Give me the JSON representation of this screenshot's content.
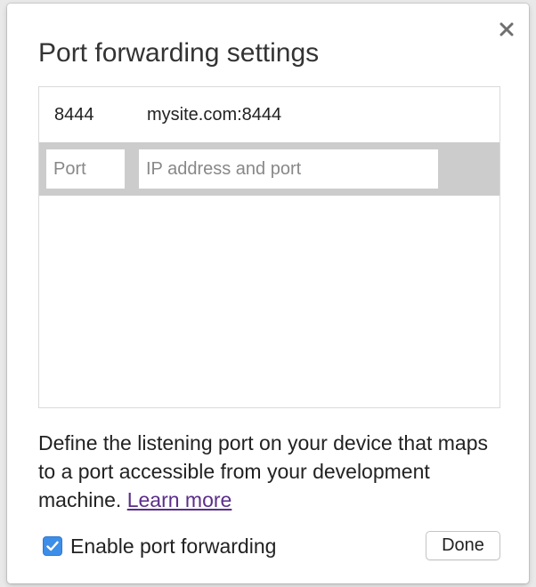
{
  "dialog": {
    "title": "Port forwarding settings",
    "close_icon": "close-icon"
  },
  "rules": [
    {
      "port": "8444",
      "address": "mysite.com:8444"
    }
  ],
  "new_rule": {
    "port_placeholder": "Port",
    "address_placeholder": "IP address and port"
  },
  "help": {
    "text": "Define the listening port on your device that maps to a port accessible from your development machine. ",
    "link_label": "Learn more"
  },
  "enable": {
    "label": "Enable port forwarding",
    "checked": true,
    "icon": "checkmark-icon"
  },
  "done_label": "Done",
  "colors": {
    "accent": "#3c8ee8",
    "link": "#5b2e8a",
    "row_highlight": "#cccccc"
  }
}
